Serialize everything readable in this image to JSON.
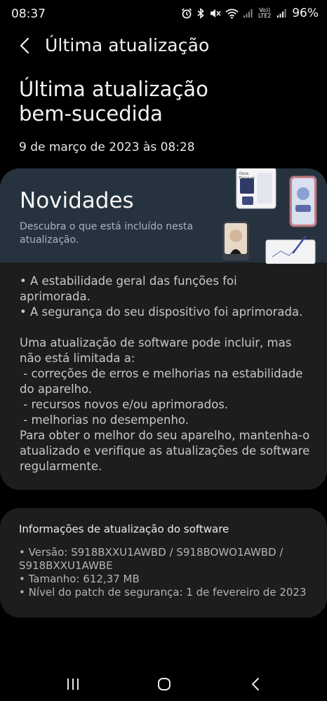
{
  "status_bar": {
    "time": "08:37",
    "network": "Vo)) LTE2",
    "battery": "96%"
  },
  "app_bar": {
    "title": "Última atualização"
  },
  "headline": {
    "line1": "Última atualização",
    "line2": "bem-sucedida"
  },
  "date": "9 de março de 2023 às 08:28",
  "news": {
    "title": "Novidades",
    "subtitle": "Descubra o que está incluído nesta atualização.",
    "promo_phone_text": "Once. Focus on what matters.",
    "items": [
      "• A estabilidade geral das funções foi aprimorada.",
      "• A segurança do seu dispositivo foi aprimorada."
    ],
    "intro": "Uma atualização de software pode incluir, mas não está limitada a:",
    "bullets": [
      " - correções de erros e melhorias na estabilidade do aparelho.",
      " - recursos novos e/ou aprimorados.",
      " - melhorias no desempenho."
    ],
    "closing": "Para obter o melhor do seu aparelho, mantenha-o atualizado e verifique as atualizações de software regularmente."
  },
  "software_info": {
    "title": "Informações de atualização do software",
    "version": "• Versão: S918BXXU1AWBD / S918BOWO1AWBD / S918BXXU1AWBE",
    "size": "• Tamanho: 612,37 MB",
    "patch": "• Nível do patch de segurança: 1 de fevereiro de 2023"
  },
  "colors": {
    "background": "#000000",
    "card": "#1d1d1f",
    "banner": "#26333e"
  },
  "icons": [
    "back-arrow-icon",
    "recent-apps-icon",
    "home-icon",
    "nav-back-icon"
  ]
}
